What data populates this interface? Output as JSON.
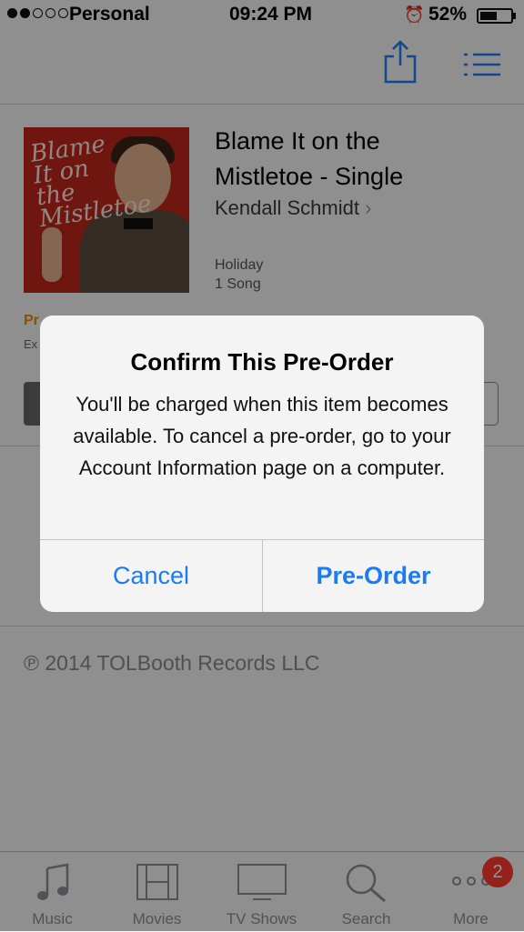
{
  "status_bar": {
    "carrier": "Personal",
    "time": "09:24 PM",
    "battery": "52%",
    "icons": [
      "signal-dots-icon",
      "alarm-icon",
      "battery-icon"
    ]
  },
  "nav": {
    "icons": [
      "share-icon",
      "list-icon"
    ]
  },
  "item": {
    "title_line1": "Blame It on the",
    "title_line2": "Mistletoe - Single",
    "artist": "Kendall Schmidt",
    "genre": "Holiday",
    "song_count": "1 Song",
    "artwork_text": "Blame It on the Mistletoe",
    "preorder_partial": "Pr",
    "expected_partial": "Ex"
  },
  "copyright": "℗ 2014 TOLBooth Records LLC",
  "alert": {
    "title": "Confirm This Pre-Order",
    "message": "You'll be charged when this item becomes available. To cancel a pre-order, go to your Account Information page on a computer.",
    "cancel_label": "Cancel",
    "confirm_label": "Pre-Order"
  },
  "tabs": [
    {
      "label": "Music",
      "icon": "music-note-icon"
    },
    {
      "label": "Movies",
      "icon": "film-strip-icon"
    },
    {
      "label": "TV Shows",
      "icon": "tv-icon"
    },
    {
      "label": "Search",
      "icon": "search-icon"
    },
    {
      "label": "More",
      "icon": "more-dots-icon"
    }
  ],
  "more_badge": "2",
  "colors": {
    "accent": "#1a7cf5",
    "preorder_orange": "#f08a00",
    "badge_red": "#ff3b30"
  }
}
